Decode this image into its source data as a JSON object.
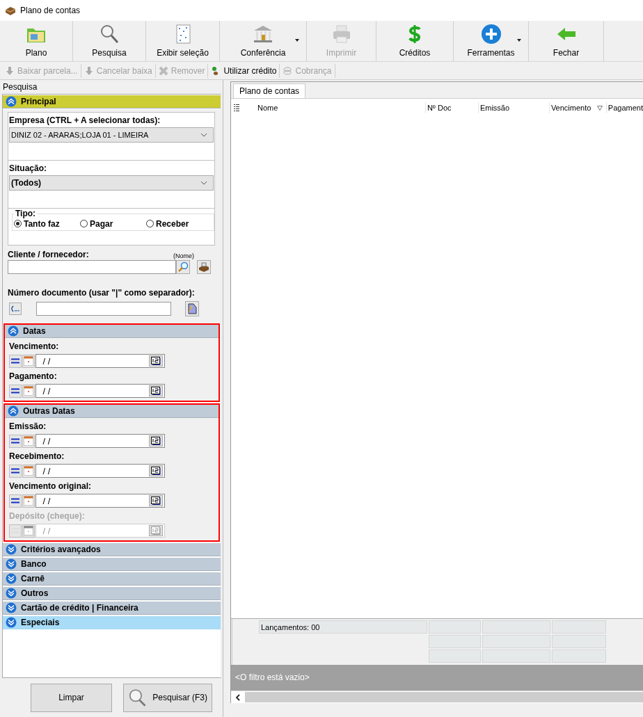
{
  "window": {
    "title": "Plano de contas"
  },
  "toolbar": [
    {
      "label": "Plano",
      "disabled": false,
      "dropdown": false
    },
    {
      "label": "Pesquisa",
      "disabled": false,
      "dropdown": false
    },
    {
      "label": "Exibir seleção",
      "disabled": false,
      "dropdown": false
    },
    {
      "label": "Conferência",
      "disabled": false,
      "dropdown": true
    },
    {
      "label": "Imprimir",
      "disabled": true,
      "dropdown": false
    },
    {
      "label": "Créditos",
      "disabled": false,
      "dropdown": false
    },
    {
      "label": "Ferramentas",
      "disabled": false,
      "dropdown": true
    },
    {
      "label": "Fechar",
      "disabled": false,
      "dropdown": false
    }
  ],
  "actions": [
    {
      "label": "Baixar parcela...",
      "disabled": true
    },
    {
      "label": "Cancelar baixa",
      "disabled": true
    },
    {
      "label": "Remover",
      "disabled": true
    },
    {
      "label": "Utilizar crédito",
      "disabled": false
    },
    {
      "label": "Cobrança",
      "disabled": true
    }
  ],
  "search_panel": {
    "title": "Pesquisa",
    "principal": {
      "header": "Principal",
      "expanded": true,
      "empresa": {
        "label": "Empresa (CTRL + A selecionar todas):",
        "value": "DINIZ 02 - ARARAS;LOJA 01 - LIMEIRA"
      },
      "situacao": {
        "label": "Situação:",
        "value": "(Todos)"
      },
      "tipo": {
        "label": "Tipo:",
        "options": [
          {
            "label": "Tanto faz",
            "selected": true
          },
          {
            "label": "Pagar",
            "selected": false
          },
          {
            "label": "Receber",
            "selected": false
          }
        ]
      },
      "cliente": {
        "label": "Cliente / fornecedor:",
        "hint": "(Nome)"
      },
      "documento": {
        "label": "Número documento (usar \"|\" como separador):"
      }
    },
    "date_groups": [
      {
        "header": "Datas",
        "expanded": true,
        "highlighted": true,
        "fields": [
          {
            "label": "Vencimento:",
            "value": " / /",
            "disabled": false
          },
          {
            "label": "Pagamento:",
            "value": " / /",
            "disabled": false
          }
        ]
      },
      {
        "header": "Outras Datas",
        "expanded": true,
        "highlighted": true,
        "fields": [
          {
            "label": "Emissão:",
            "value": " / /",
            "disabled": false
          },
          {
            "label": "Recebimento:",
            "value": " / /",
            "disabled": false
          },
          {
            "label": "Vencimento original:",
            "value": " / /",
            "disabled": false
          },
          {
            "label": "Depósito (cheque):",
            "value": " / /",
            "disabled": true
          }
        ]
      }
    ],
    "sections": [
      {
        "header": "Critérios avançados",
        "expanded": false,
        "selected": false
      },
      {
        "header": "Banco",
        "expanded": false,
        "selected": false
      },
      {
        "header": "Carnê",
        "expanded": false,
        "selected": false
      },
      {
        "header": "Outros",
        "expanded": false,
        "selected": false
      },
      {
        "header": "Cartão de crédito | Financeira",
        "expanded": false,
        "selected": false
      },
      {
        "header": "Especiais",
        "expanded": false,
        "selected": true
      }
    ],
    "buttons": [
      {
        "label": "Limpar"
      },
      {
        "label": "Pesquisar (F3)"
      }
    ]
  },
  "grid": {
    "tab": {
      "label": "Plano de contas",
      "selected": true
    },
    "columns": [
      {
        "label": "Nome",
        "sorted": false
      },
      {
        "label": "Nº Doc",
        "sorted": false
      },
      {
        "label": "Emissão",
        "sorted": false
      },
      {
        "label": "Vencimento",
        "sorted": true
      },
      {
        "label": "Pagament",
        "sorted": false
      }
    ],
    "summary": "Lançamentos: 00",
    "filter": "<O filtro está vazio>"
  }
}
